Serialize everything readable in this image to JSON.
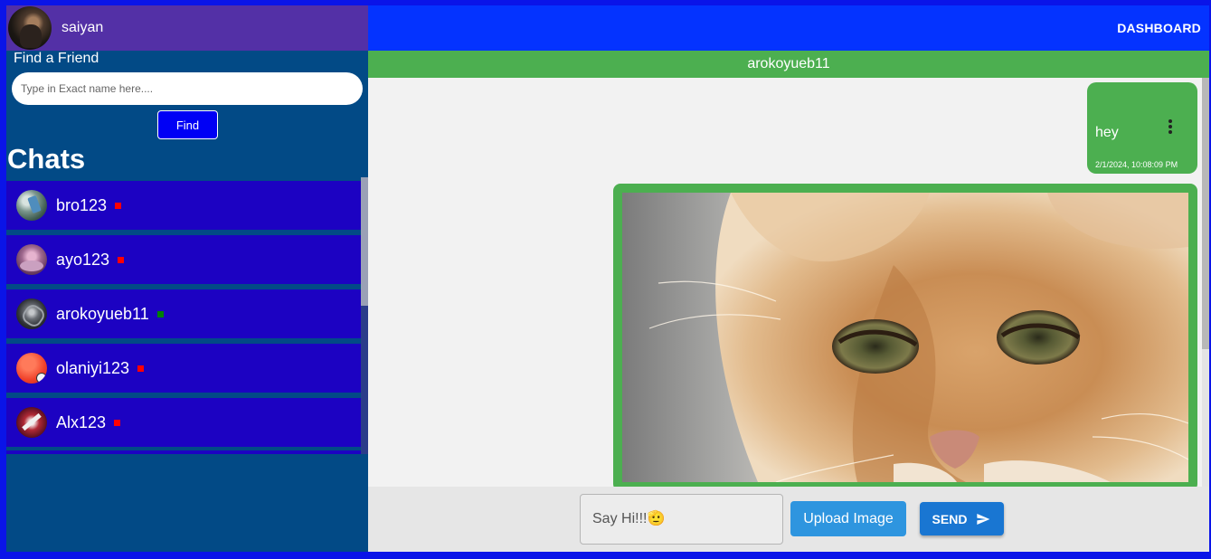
{
  "user": {
    "name": "saiyan",
    "avatar_icon": "user-avatar"
  },
  "search": {
    "label": "Find a Friend",
    "placeholder": "Type in Exact name here....",
    "value": "",
    "button_label": "Find"
  },
  "chats": {
    "heading": "Chats",
    "items": [
      {
        "name": "bro123",
        "status": "offline",
        "status_color": "#ff0000"
      },
      {
        "name": "ayo123",
        "status": "offline",
        "status_color": "#ff0000"
      },
      {
        "name": "arokoyueb11",
        "status": "online",
        "status_color": "#008000"
      },
      {
        "name": "olaniyi123",
        "status": "offline",
        "status_color": "#ff0000"
      },
      {
        "name": "Alx123",
        "status": "offline",
        "status_color": "#ff0000"
      }
    ]
  },
  "nav": {
    "dashboard_label": "DASHBOARD"
  },
  "conversation": {
    "title": "arokoyueb11",
    "messages": [
      {
        "type": "text",
        "text": "hey",
        "timestamp": "2/1/2024, 10:08:09 PM"
      },
      {
        "type": "image",
        "image_icon": "cat-photo"
      }
    ]
  },
  "composer": {
    "placeholder": "Say Hi!!!🫡",
    "value": "",
    "upload_label": "Upload Image",
    "send_label": "SEND"
  },
  "colors": {
    "profile_bar": "#5330a6",
    "sidebar": "#024a86",
    "chat_item": "#1c02c2",
    "topbar": "#0433ff",
    "accent_green": "#4caf50",
    "send_button": "#1976d2",
    "upload_button": "#2e95df"
  }
}
